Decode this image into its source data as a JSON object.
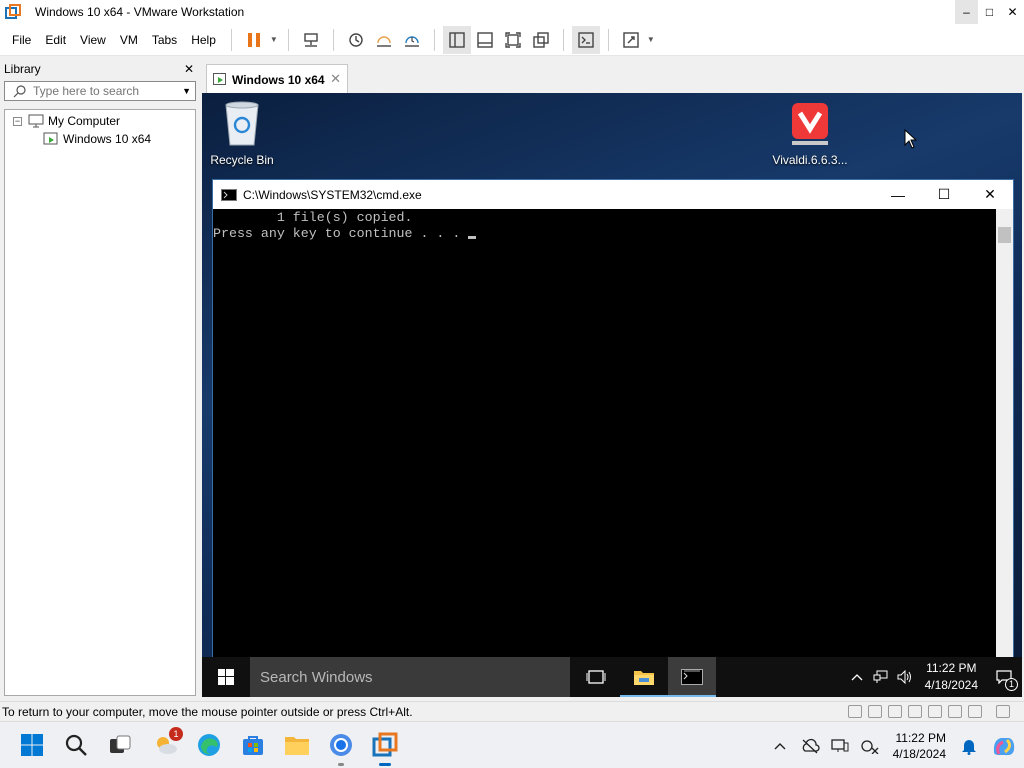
{
  "host_window": {
    "title": "Windows 10 x64 - VMware Workstation",
    "controls": {
      "minimize": "–",
      "maximize": "□",
      "close": "✕"
    }
  },
  "menu": {
    "items": [
      "File",
      "Edit",
      "View",
      "VM",
      "Tabs",
      "Help"
    ]
  },
  "library": {
    "title": "Library",
    "close": "✕",
    "search_placeholder": "Type here to search",
    "tree": {
      "root_expander": "−",
      "root": "My Computer",
      "child": "Windows 10 x64"
    }
  },
  "vm_tab": {
    "label": "Windows 10 x64",
    "close": "✕"
  },
  "desktop": {
    "icons": [
      {
        "label": "Recycle Bin"
      },
      {
        "label": "Vivaldi.6.6.3..."
      }
    ]
  },
  "cmd": {
    "title": "C:\\Windows\\SYSTEM32\\cmd.exe",
    "lines": [
      "        1 file(s) copied.",
      "Press any key to continue . . . "
    ],
    "controls": {
      "minimize": "—",
      "maximize": "☐",
      "close": "✕"
    }
  },
  "guest_taskbar": {
    "search_placeholder": "Search Windows",
    "time": "11:22 PM",
    "date": "4/18/2024",
    "notification_count": "1"
  },
  "statusbar": {
    "message": "To return to your computer, move the mouse pointer outside or press Ctrl+Alt."
  },
  "host_taskbar": {
    "weather_badge": "1",
    "time": "11:22 PM",
    "date": "4/18/2024"
  },
  "colors": {
    "accent": "#0067c0",
    "vmware_orange": "#e87722",
    "pause_orange": "#e8751a",
    "vivaldi_red": "#ef3939"
  }
}
